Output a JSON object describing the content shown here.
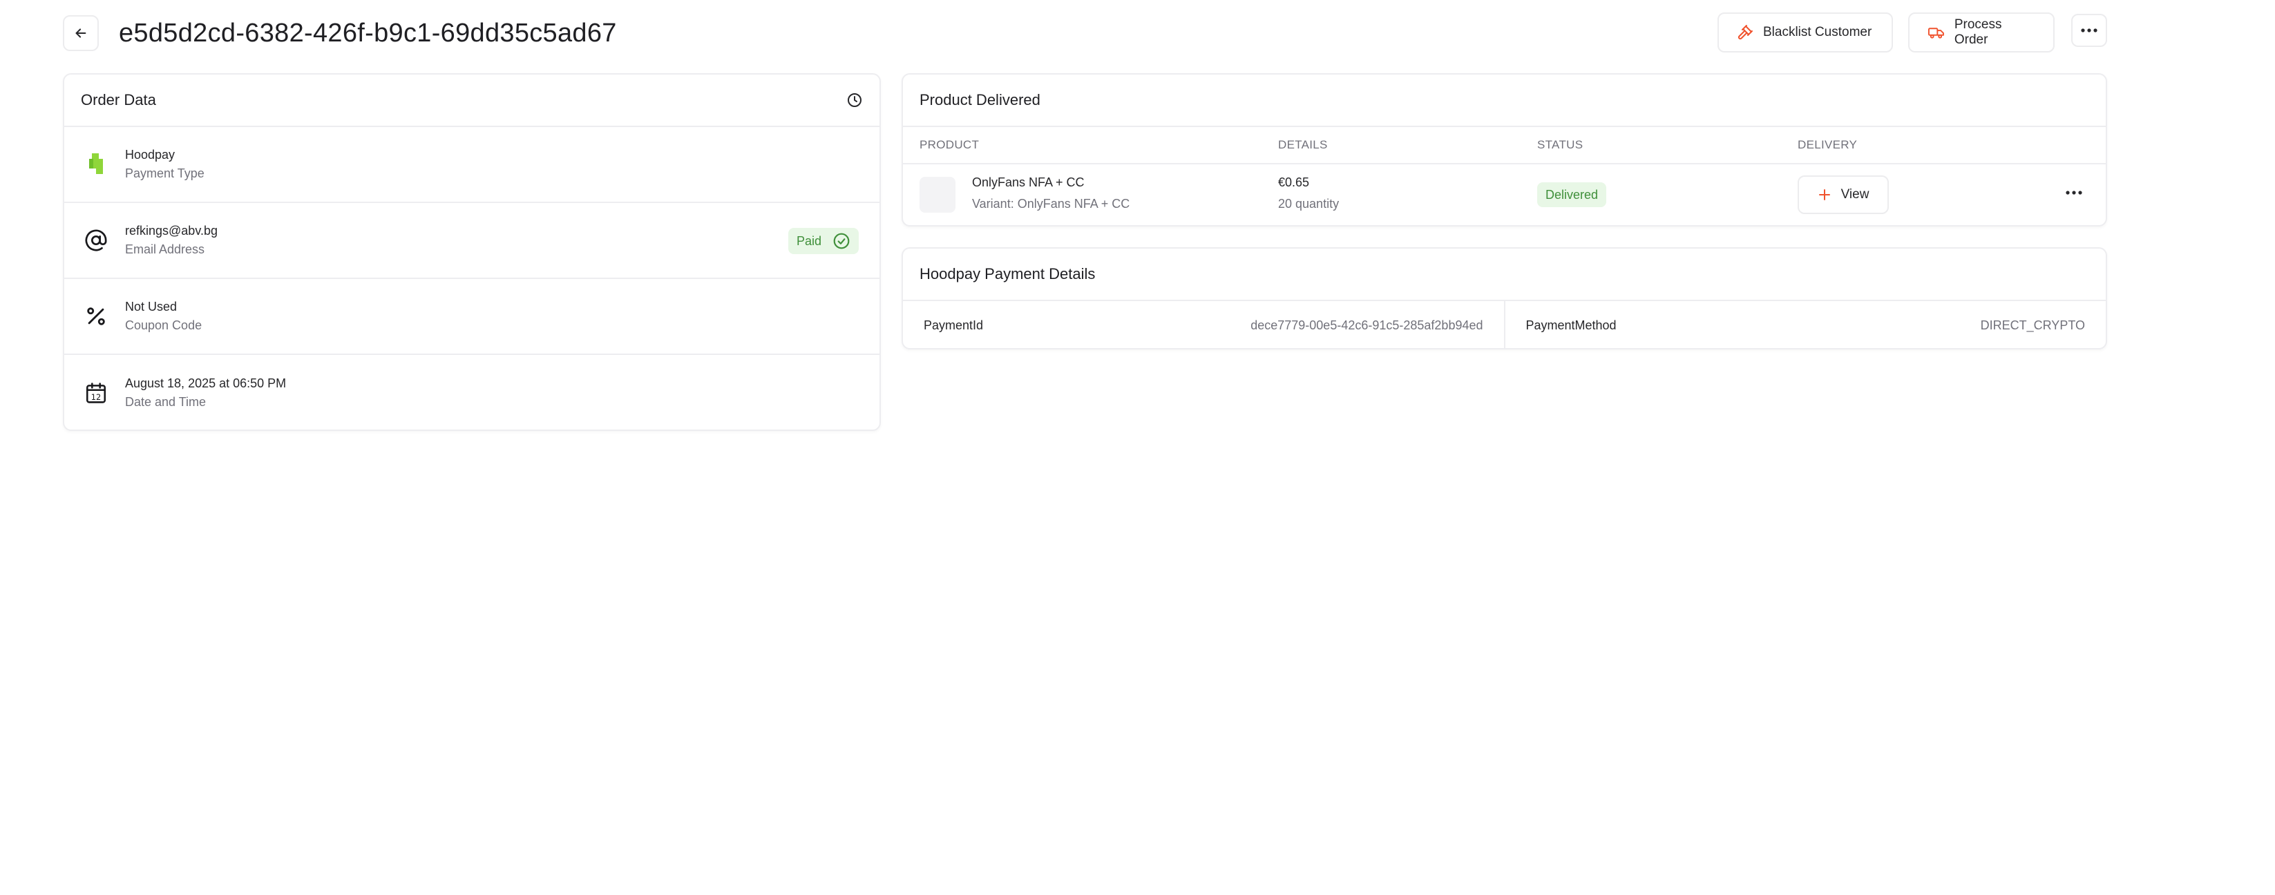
{
  "header": {
    "order_id": "e5d5d2cd-6382-426f-b9c1-69dd35c5ad67",
    "blacklist_label": "Blacklist Customer",
    "process_label": "Process Order"
  },
  "order_data": {
    "title": "Order Data",
    "rows": [
      {
        "primary": "Hoodpay",
        "secondary": "Payment Type",
        "icon": "hoodpay-logo-icon"
      },
      {
        "primary": "refkings@abv.bg",
        "secondary": "Email Address",
        "icon": "at-sign-icon",
        "badge": "Paid"
      },
      {
        "primary": "Not Used",
        "secondary": "Coupon Code",
        "icon": "percent-icon"
      },
      {
        "primary": "August 18, 2025 at 06:50 PM",
        "secondary": "Date and Time",
        "icon": "calendar-icon",
        "calendar_day": "12"
      }
    ]
  },
  "product_delivered": {
    "title": "Product Delivered",
    "columns": [
      "PRODUCT",
      "DETAILS",
      "STATUS",
      "DELIVERY"
    ],
    "items": [
      {
        "name": "OnlyFans NFA + CC",
        "variant": "Variant: OnlyFans NFA + CC",
        "price": "€0.65",
        "quantity": "20 quantity",
        "status": "Delivered",
        "view_label": "View"
      }
    ]
  },
  "payment_details": {
    "title": "Hoodpay Payment Details",
    "fields": [
      {
        "key": "PaymentId",
        "value": "dece7779-00e5-42c6-91c5-285af2bb94ed"
      },
      {
        "key": "PaymentMethod",
        "value": "DIRECT_CRYPTO"
      }
    ]
  },
  "colors": {
    "accent": "#f0522d",
    "success_bg": "#e8f7e6",
    "success_text": "#3f8f3a",
    "hoodpay_green": "#8fd63a"
  }
}
